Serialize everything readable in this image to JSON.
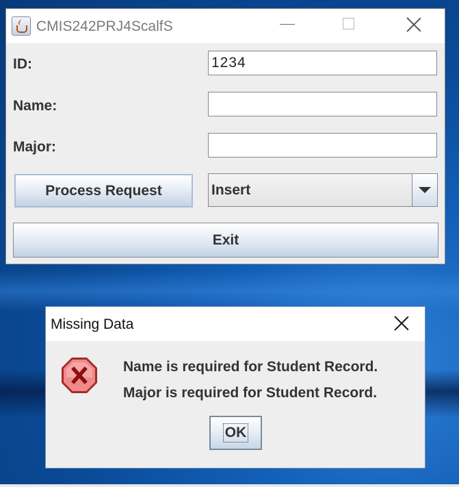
{
  "main_window": {
    "title": "CMIS242PRJ4ScalfS",
    "fields": {
      "id_label": "ID:",
      "id_value": "1234",
      "name_label": "Name:",
      "name_value": "",
      "major_label": "Major:",
      "major_value": ""
    },
    "process_button": "Process Request",
    "request_type_selected": "Insert",
    "exit_button": "Exit"
  },
  "dialog": {
    "title": "Missing Data",
    "icon": "error-icon",
    "messages": [
      "Name is required for Student Record.",
      "Major is required for Student Record."
    ],
    "ok_button": "OK"
  },
  "colors": {
    "desktop": "#0a4a96",
    "window_bg": "#eeeeee",
    "error_icon": "#e57373"
  }
}
